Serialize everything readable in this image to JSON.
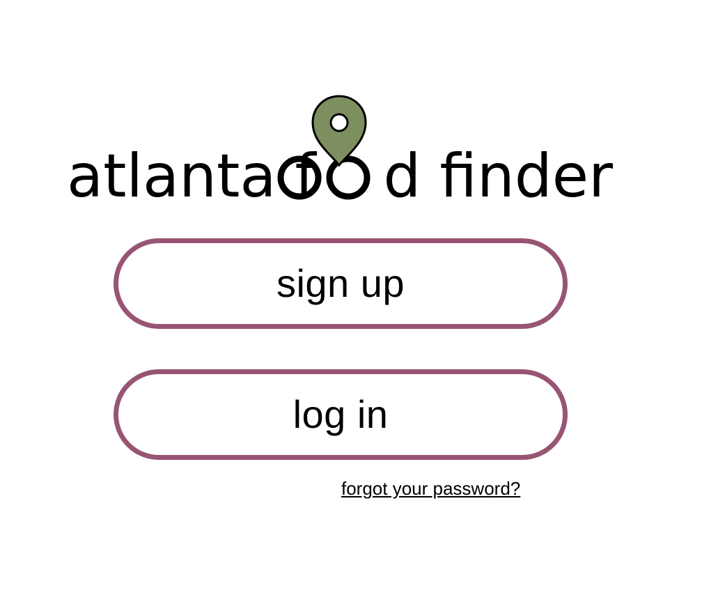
{
  "logo": {
    "text_part1": "atlanta f",
    "text_part2": "d finder",
    "pin_color": "#7E8F5F",
    "pin_icon": "location-pin-icon"
  },
  "buttons": {
    "signup_label": "sign up",
    "login_label": "log in",
    "border_color": "#985573"
  },
  "links": {
    "forgot_password": "forgot your password?"
  }
}
